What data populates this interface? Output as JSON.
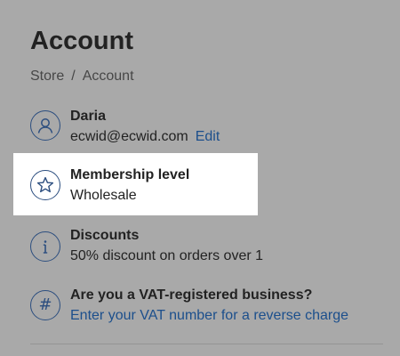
{
  "page": {
    "title": "Account",
    "breadcrumb": [
      {
        "label": "Store"
      },
      {
        "label": "Account"
      }
    ],
    "separator": "/"
  },
  "profile": {
    "icon": "user-icon",
    "name": "Daria",
    "email": "ecwid@ecwid.com",
    "edit_label": "Edit"
  },
  "membership": {
    "icon": "star-icon",
    "title": "Membership level",
    "value": "Wholesale",
    "highlighted": true
  },
  "discounts": {
    "icon": "info-icon",
    "title": "Discounts",
    "value": "50% discount on orders over 1"
  },
  "vat": {
    "icon": "hash-icon",
    "title": "Are you a VAT-registered business?",
    "link_label": "Enter your VAT number for a reverse charge"
  },
  "colors": {
    "overlay": "#a9a9a9",
    "highlight": "#ffffff",
    "link": "#1c4f8c",
    "icon": "#2c4e7f",
    "text": "#222222"
  }
}
